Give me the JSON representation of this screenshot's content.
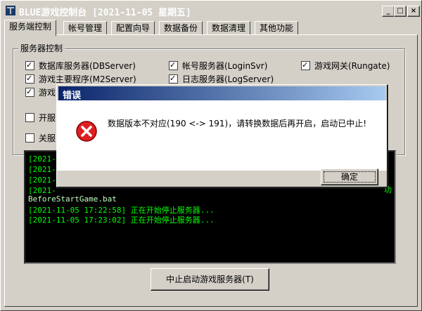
{
  "window": {
    "title": "BLUE游戏控制台 [2021-11-05 星期五]",
    "buttons": {
      "minimize": "_",
      "maximize": "□",
      "close": "×"
    }
  },
  "tabs": [
    "服务端控制",
    "帐号管理",
    "配置向导",
    "数据备份",
    "数据清理",
    "其他功能"
  ],
  "server_group": {
    "label": "服务器控制",
    "checkboxes": [
      {
        "label": "数据库服务器(DBServer)",
        "checked": true
      },
      {
        "label": "帐号服务器(LoginSvr)",
        "checked": true
      },
      {
        "label": "游戏网关(Rungate)",
        "checked": true
      },
      {
        "label": "游戏主要程序(M2Server)",
        "checked": true
      },
      {
        "label": "日志服务器(LogServer)",
        "checked": true
      },
      {
        "label": "游戏",
        "checked": true
      }
    ],
    "options": [
      {
        "label": "开服",
        "checked": false
      },
      {
        "label": "关服",
        "checked": false
      }
    ]
  },
  "log": {
    "lines": [
      "[2021-",
      "[2021-",
      "[2021-",
      "[2021-",
      "BeforeStartGame.bat",
      "[2021-11-05 17:22:58] 正在开始停止服务器...",
      "[2021-11-05 17:23:02] 正在开始停止服务器..."
    ],
    "right_edge_char": "功"
  },
  "main_button": "中止启动游戏服务器(T)",
  "dialog": {
    "title": "错误",
    "message": "数据版本不对应(190 <-> 191)，请转换数据后再开启，启动已中止!",
    "ok": "确定"
  }
}
